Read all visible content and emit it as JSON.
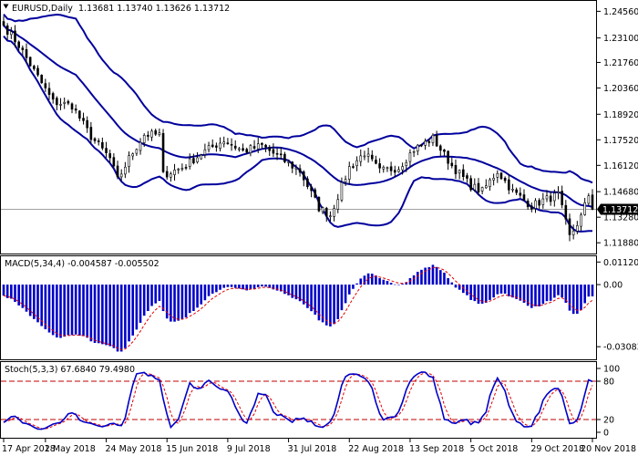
{
  "colors": {
    "background": "#ffffff",
    "frame": "#000000",
    "bollinger": "#00009c",
    "candle_up": "#ffffff",
    "candle_down": "#000000",
    "candle_outline": "#000000",
    "macd_histogram": "#0000c8",
    "macd_signal": "#e00000",
    "stoch_main": "#0000c8",
    "stoch_signal": "#e00000",
    "stoch_levels": "#c00000",
    "price_line": "#a0a0a0",
    "price_label_bg": "#000000",
    "price_label_text": "#ffffff"
  },
  "chart_data": [
    {
      "type": "candlestick",
      "panel": "price",
      "title": "EURUSD,Daily",
      "ohlc_header": "1.13681 1.13740 1.13626 1.13712",
      "current_price": 1.13712,
      "current_price_label": "1.13712",
      "ylim": [
        1.1129,
        1.2508
      ],
      "y_ticks": [
        "1.24560",
        "1.23100",
        "1.21760",
        "1.20360",
        "1.18920",
        "1.17520",
        "1.16120",
        "1.14680",
        "1.13280",
        "1.11880"
      ],
      "x_start": "2018-04-17",
      "x_end": "2018-11-20",
      "x_tick_labels": [
        "17 Apr 2018",
        "2 May 2018",
        "24 May 2018",
        "15 Jun 2018",
        "9 Jul 2018",
        "31 Jul 2018",
        "22 Aug 2018",
        "13 Sep 2018",
        "5 Oct 2018",
        "29 Oct 2018",
        "20 Nov 2018"
      ],
      "close_anchors": [
        [
          "2018-04-17",
          1.238
        ],
        [
          "2018-04-23",
          1.227
        ],
        [
          "2018-04-27",
          1.213
        ],
        [
          "2018-05-04",
          1.196
        ],
        [
          "2018-05-11",
          1.194
        ],
        [
          "2018-05-18",
          1.177
        ],
        [
          "2018-05-25",
          1.165
        ],
        [
          "2018-05-29",
          1.153
        ],
        [
          "2018-06-01",
          1.165
        ],
        [
          "2018-06-07",
          1.178
        ],
        [
          "2018-06-13",
          1.178
        ],
        [
          "2018-06-14",
          1.156
        ],
        [
          "2018-06-21",
          1.16
        ],
        [
          "2018-06-29",
          1.169
        ],
        [
          "2018-07-06",
          1.175
        ],
        [
          "2018-07-13",
          1.169
        ],
        [
          "2018-07-20",
          1.172
        ],
        [
          "2018-07-27",
          1.165
        ],
        [
          "2018-08-03",
          1.158
        ],
        [
          "2018-08-10",
          1.138
        ],
        [
          "2018-08-15",
          1.134
        ],
        [
          "2018-08-22",
          1.16
        ],
        [
          "2018-08-28",
          1.168
        ],
        [
          "2018-09-03",
          1.158
        ],
        [
          "2018-09-10",
          1.16
        ],
        [
          "2018-09-14",
          1.17
        ],
        [
          "2018-09-21",
          1.176
        ],
        [
          "2018-09-28",
          1.161
        ],
        [
          "2018-10-05",
          1.15
        ],
        [
          "2018-10-10",
          1.147
        ],
        [
          "2018-10-16",
          1.158
        ],
        [
          "2018-10-22",
          1.147
        ],
        [
          "2018-10-29",
          1.139
        ],
        [
          "2018-11-01",
          1.142
        ],
        [
          "2018-11-07",
          1.145
        ],
        [
          "2018-11-12",
          1.122
        ],
        [
          "2018-11-15",
          1.133
        ],
        [
          "2018-11-19",
          1.145
        ],
        [
          "2018-11-20",
          1.1371
        ]
      ],
      "bollinger": {
        "period": 20,
        "deviations": 2
      }
    },
    {
      "type": "histogram",
      "panel": "macd",
      "title": "MACD(5,34,4) -0.004587 -0.005502",
      "ylim": [
        -0.0362,
        0.0136
      ],
      "y_ticks": [
        "0.011208",
        "0.00",
        "-0.030833"
      ],
      "series": [
        {
          "name": "MACD",
          "render": "bars"
        },
        {
          "name": "Signal",
          "render": "dashed-line"
        }
      ]
    },
    {
      "type": "line",
      "panel": "stochastic",
      "title": "Stoch(5,3,3) 67.6840 79.4980",
      "ylim": [
        0,
        100
      ],
      "y_ticks": [
        "100",
        "80",
        "20",
        "0"
      ],
      "levels": [
        80,
        20
      ],
      "series": [
        {
          "name": "%K",
          "render": "solid-line"
        },
        {
          "name": "%D",
          "render": "dashed-line"
        }
      ]
    }
  ]
}
